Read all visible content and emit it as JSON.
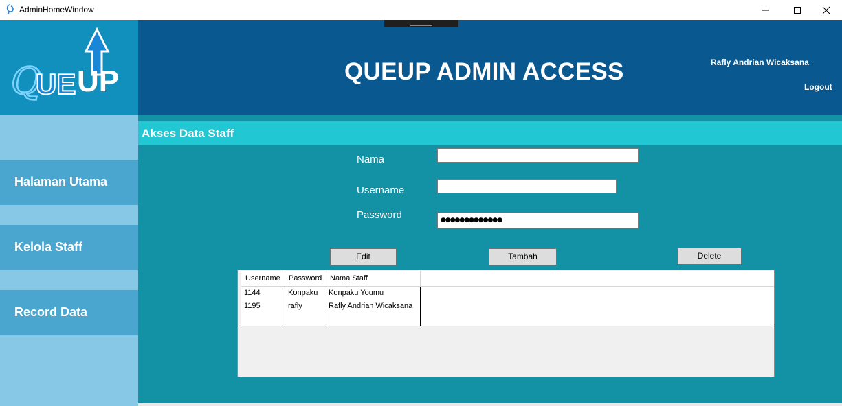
{
  "window": {
    "title": "AdminHomeWindow"
  },
  "logo": {
    "text_q": "Q",
    "text_ue": "UE",
    "text_up": "UP"
  },
  "header": {
    "title": "QUEUP ADMIN ACCESS",
    "user_name": "Rafly Andrian Wicaksana",
    "logout_label": "Logout"
  },
  "sidebar": {
    "items": [
      {
        "label": "Halaman Utama"
      },
      {
        "label": "Kelola Staff"
      },
      {
        "label": "Record Data"
      }
    ]
  },
  "section": {
    "title": "Akses Data Staff"
  },
  "form": {
    "nama_label": "Nama",
    "nama_value": "",
    "username_label": "Username",
    "username_value": "",
    "password_label": "Password",
    "password_value": "●●●●●●●●●●●●●"
  },
  "buttons": {
    "edit": "Edit",
    "tambah": "Tambah",
    "delete": "Delete"
  },
  "grid": {
    "columns": [
      "Username",
      "Password",
      "Nama Staff"
    ],
    "rows": [
      [
        "1144",
        "Konpaku",
        "Konpaku Youmu"
      ],
      [
        "1195",
        "rafly",
        "Rafly Andrian Wicaksana"
      ],
      [
        "",
        "",
        ""
      ]
    ]
  },
  "colors": {
    "sidebar_dark": "#1190bd",
    "sidebar_light": "#87c8e6",
    "nav_item": "#4aa5cf",
    "header": "#0a5890",
    "main": "#1392a6",
    "section_bar": "#21c8d3"
  }
}
